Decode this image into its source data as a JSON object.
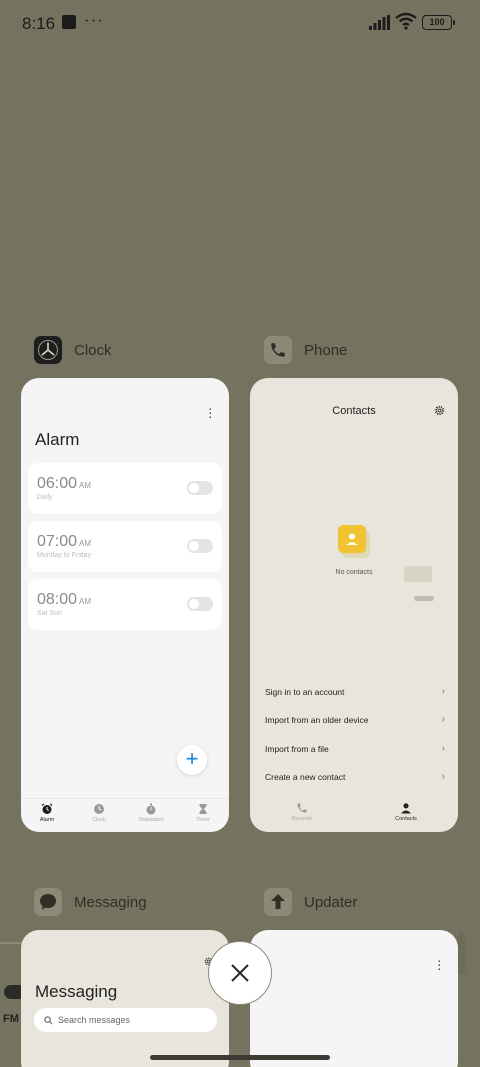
{
  "status_bar": {
    "time": "8:16",
    "dots": "···",
    "battery": "100"
  },
  "apps": {
    "clock": {
      "name": "Clock",
      "title": "Alarm",
      "alarms": [
        {
          "time": "06:00",
          "ampm": "AM",
          "repeat": "Daily"
        },
        {
          "time": "07:00",
          "ampm": "AM",
          "repeat": "Monday to Friday"
        },
        {
          "time": "08:00",
          "ampm": "AM",
          "repeat": "Sat Sun"
        }
      ],
      "add_symbol": "+",
      "nav": [
        "Alarm",
        "Clock",
        "Stopwatch",
        "Timer"
      ]
    },
    "phone": {
      "name": "Phone",
      "title": "Contacts",
      "empty_text": "No contacts",
      "menu": [
        "Sign in to an account",
        "Import from an older device",
        "Import from a file",
        "Create a new contact"
      ],
      "nav": [
        "Recents",
        "Contacts"
      ]
    },
    "messaging": {
      "name": "Messaging",
      "title": "Messaging",
      "search_placeholder": "Search messages"
    },
    "updater": {
      "name": "Updater"
    }
  },
  "background": {
    "fm_label": "FM"
  },
  "colors": {
    "background": "#75735f",
    "accent_blue": "#1a83d6",
    "contact_yellow": "#f1c232"
  }
}
